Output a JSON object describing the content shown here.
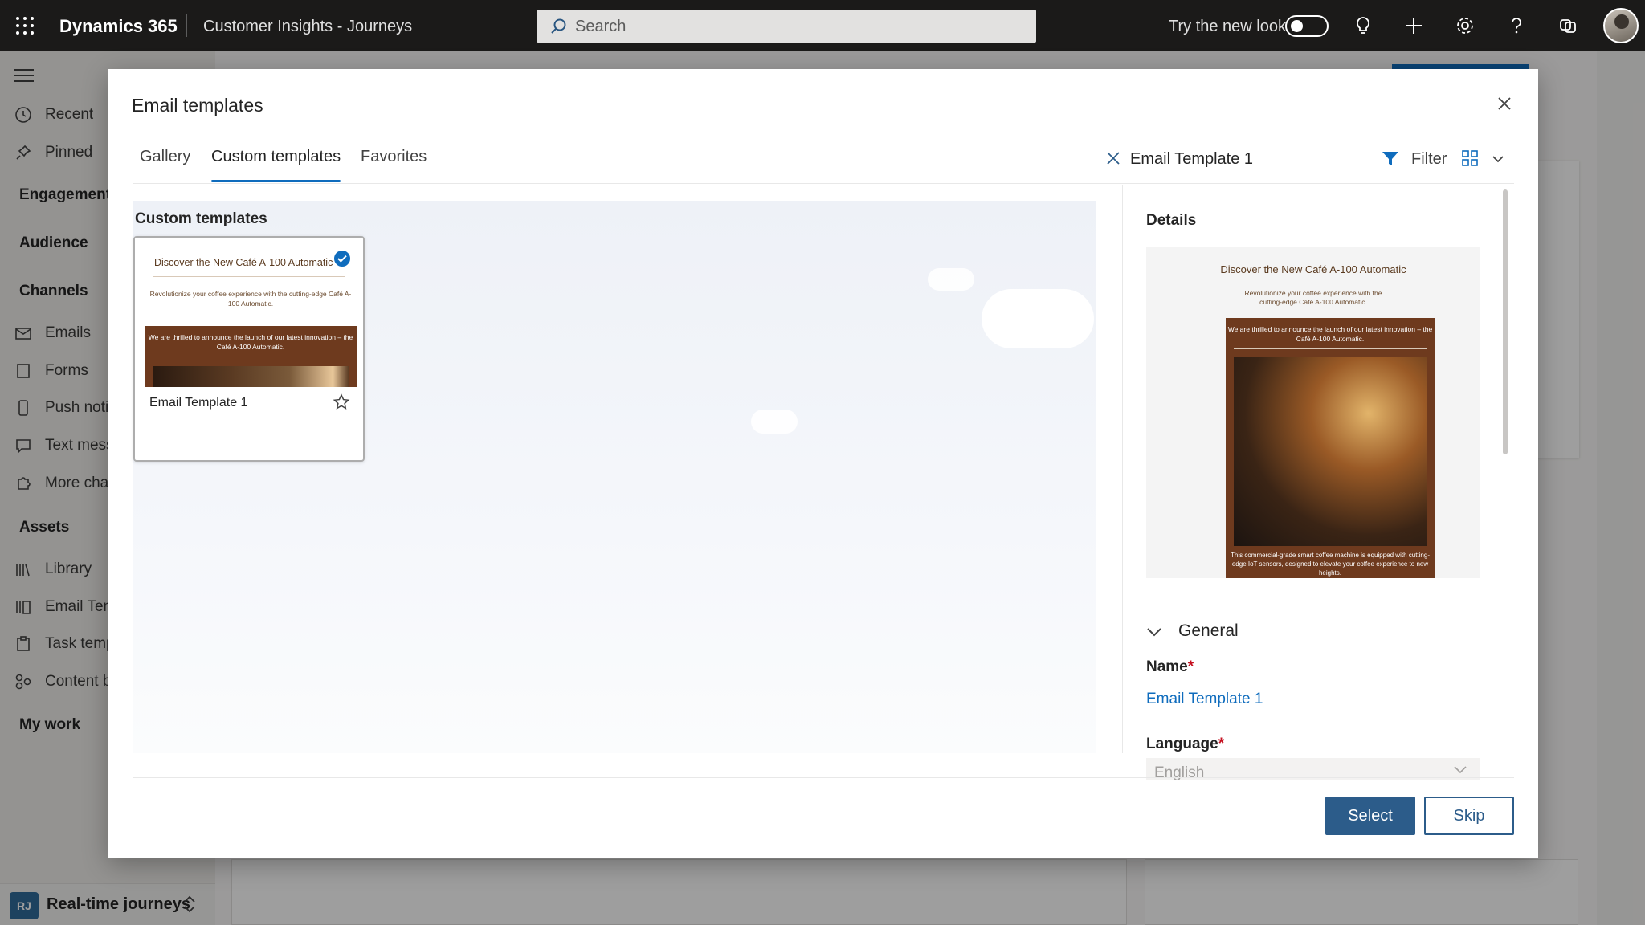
{
  "topbar": {
    "brand": "Dynamics 365",
    "app_name": "Customer Insights - Journeys",
    "search_placeholder": "Search",
    "try_new_look": "Try the new look"
  },
  "nav": {
    "recent": "Recent",
    "pinned": "Pinned",
    "engagement": "Engagement",
    "audience": "Audience",
    "channels": "Channels",
    "emails": "Emails",
    "forms": "Forms",
    "push": "Push noti",
    "text": "Text mess",
    "more": "More cha",
    "assets": "Assets",
    "library": "Library",
    "email_templates": "Email Ten",
    "task_templates": "Task temp",
    "content": "Content b",
    "my_work": "My work",
    "area_badge": "RJ",
    "area": "Real-time journeys"
  },
  "dialog": {
    "title": "Email templates",
    "tabs": [
      "Gallery",
      "Custom templates",
      "Favorites"
    ],
    "active_tab": "Custom templates",
    "filter_value": "Email Template 1",
    "filter_label": "Filter",
    "section_title": "Custom templates",
    "card": {
      "heading": "Discover the New Café A-100 Automatic",
      "subtext": "Revolutionize your coffee experience with the cutting-edge Café A-100 Automatic.",
      "band_text": "We are thrilled to announce the launch of our latest innovation – the Café A-100 Automatic.",
      "name": "Email Template 1"
    },
    "details": {
      "title": "Details",
      "preview_heading": "Discover the New Café A-100 Automatic",
      "preview_subtext": "Revolutionize your coffee experience with the cutting-edge Café A-100 Automatic.",
      "preview_band_text": "We are thrilled to announce the launch of our latest innovation – the Café A-100 Automatic.",
      "preview_bottom": "This commercial-grade smart coffee machine is equipped with cutting-edge IoT sensors, designed to elevate your coffee experience to new heights.",
      "general": "General",
      "name_label": "Name",
      "name_value": "Email Template 1",
      "language_label": "Language",
      "language_value": "English",
      "required_mark": "*"
    },
    "select_label": "Select",
    "skip_label": "Skip"
  },
  "colors": {
    "accent": "#0f6cbd",
    "button": "#2c5c8a",
    "email_brown": "#6e3a1e"
  }
}
